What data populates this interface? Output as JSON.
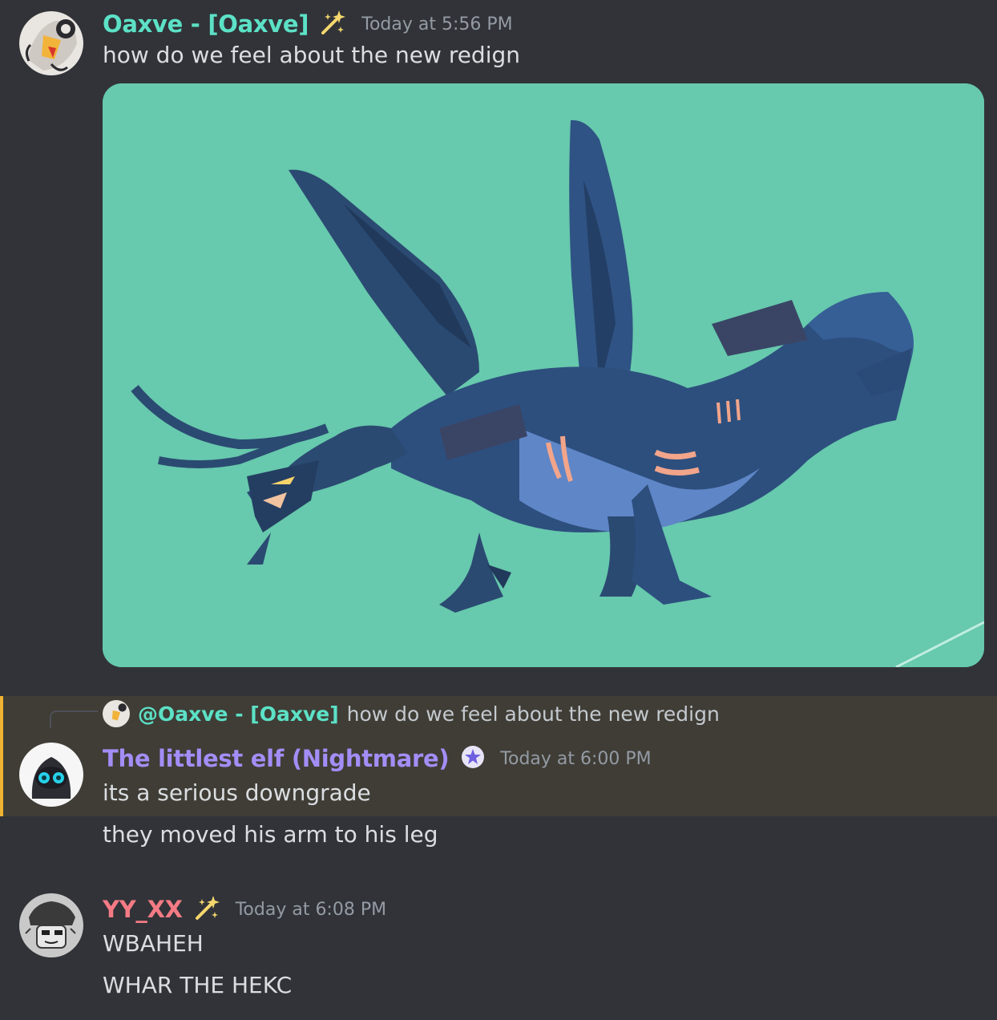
{
  "messages": [
    {
      "author": "Oaxve - [Oaxve]",
      "author_color": "#5ce1c6",
      "badge_icon": "sparkle-wand-icon",
      "timestamp": "Today at 5:56 PM",
      "lines": [
        "how do we feel about the new redign"
      ],
      "attachment": {
        "kind": "image",
        "description_icon": "dragon-image"
      }
    },
    {
      "reply_to": {
        "mention": "@Oaxve - [Oaxve]",
        "text": "how do we feel about the new redign"
      },
      "author": "The littlest elf (Nightmare)",
      "author_color": "#a28ef7",
      "badge_icon": "shield-star-icon",
      "timestamp": "Today at 6:00 PM",
      "lines": [
        "its a serious downgrade",
        "they moved his arm to his leg"
      ]
    },
    {
      "author": "YY_XX",
      "author_color": "#f47b85",
      "badge_icon": "sparkle-wand-icon",
      "timestamp": "Today at 6:08 PM",
      "lines": [
        "WBAHEH",
        "WHAR THE HEKC"
      ]
    }
  ],
  "colors": {
    "background": "#313338",
    "mention_highlight": "#3f3d36",
    "mention_bar": "#f0b232",
    "image_bg": "#67c9ad"
  }
}
